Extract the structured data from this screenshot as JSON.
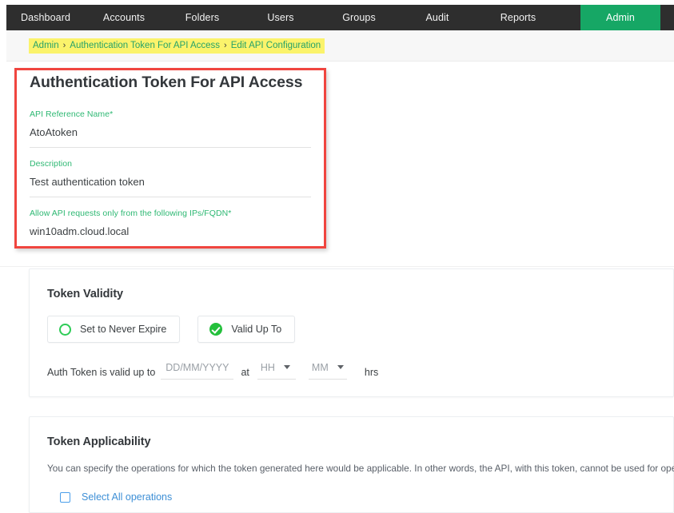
{
  "nav": {
    "items": [
      {
        "label": "Dashboard",
        "active": false
      },
      {
        "label": "Accounts",
        "active": false
      },
      {
        "label": "Folders",
        "active": false
      },
      {
        "label": "Users",
        "active": false
      },
      {
        "label": "Groups",
        "active": false
      },
      {
        "label": "Audit",
        "active": false
      },
      {
        "label": "Reports",
        "active": false
      },
      {
        "label": "Admin",
        "active": true
      }
    ]
  },
  "breadcrumb": {
    "root": "Admin",
    "middle": "Authentication Token For API Access",
    "current": "Edit API Configuration",
    "separator": "›"
  },
  "page": {
    "title": "Authentication Token For API Access"
  },
  "form": {
    "api_reference_name": {
      "label": "API Reference Name*",
      "value": "AtoAtoken"
    },
    "description": {
      "label": "Description",
      "value": "Test authentication token"
    },
    "allowed_ips": {
      "label": "Allow API requests only from the following IPs/FQDN*",
      "value": "win10adm.cloud.local"
    }
  },
  "token_validity": {
    "title": "Token Validity",
    "options": [
      {
        "label": "Set to Never Expire",
        "selected": false,
        "icon": "radio-ring-icon"
      },
      {
        "label": "Valid Up To",
        "selected": true,
        "icon": "check-circle-icon"
      }
    ],
    "valid_up_to": {
      "prefix": "Auth Token is valid up to",
      "date_placeholder": "DD/MM/YYYY",
      "at_label": "at",
      "hour_value": "HH",
      "minute_value": "MM",
      "suffix": "hrs"
    }
  },
  "token_applicability": {
    "title": "Token Applicability",
    "description": "You can specify the operations for which the token generated here would be applicable. In other words, the API, with this token, cannot be used for operations",
    "select_all": {
      "label": "Select All operations",
      "checked": false
    }
  },
  "colors": {
    "nav_bg": "#2e2e2e",
    "accent_green": "#16a765",
    "label_green": "#2eb873",
    "highlight_yellow": "#fbf36b",
    "annotation_red": "#f0453f",
    "link_blue": "#3d8fd6"
  }
}
